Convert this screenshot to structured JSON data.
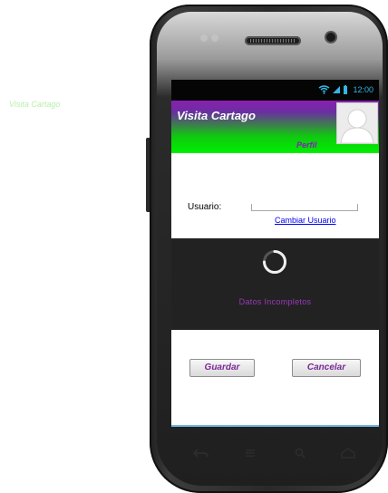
{
  "watermark": {
    "text": "Visita Cartago"
  },
  "status_bar": {
    "time": "12:00",
    "accent_color": "#33b5e5"
  },
  "header": {
    "title": "Visita Cartago",
    "profile_label": "Perfil",
    "gradient": [
      "#8a1fb0",
      "#00f000"
    ]
  },
  "form": {
    "user_label": "Usuario:",
    "user_value": "",
    "change_user_link": "Cambiar Usuario"
  },
  "loading": {
    "message": "Datos Incompletos"
  },
  "actions": {
    "save_label": "Guardar",
    "cancel_label": "Cancelar"
  },
  "icons": {
    "wifi": "wifi-icon",
    "signal": "signal-icon",
    "battery": "battery-icon",
    "avatar": "avatar-icon",
    "spinner": "loading-spinner-icon",
    "back": "back-icon",
    "menu": "menu-icon",
    "search": "search-icon",
    "home": "home-icon"
  },
  "colors": {
    "brand_purple": "#8a1bbb",
    "brand_green": "#00f000",
    "loading_background": "#222222",
    "link_blue": "#0000ee"
  }
}
